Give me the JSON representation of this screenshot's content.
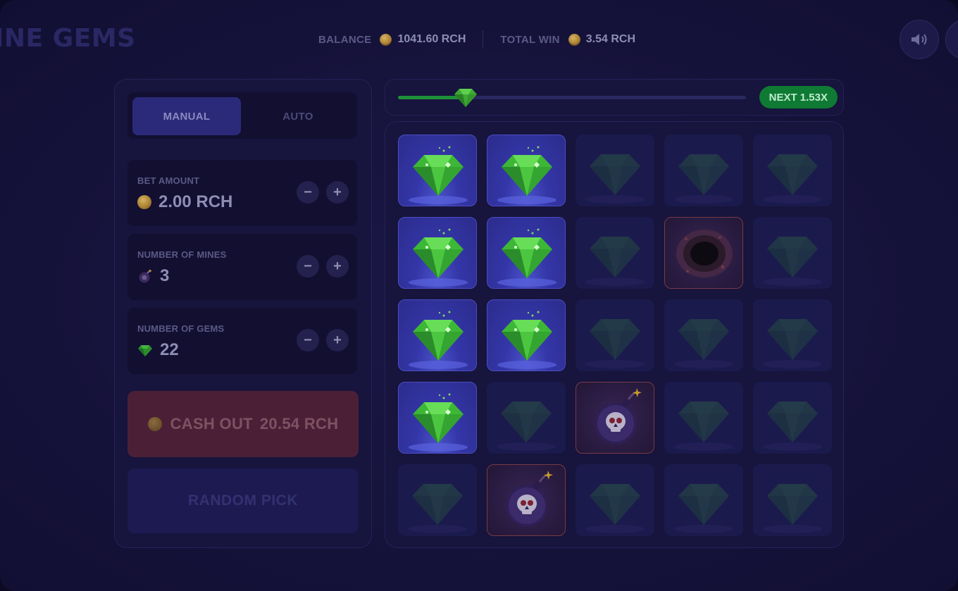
{
  "app": {
    "title_fragment": "INE GEMS"
  },
  "header": {
    "balance_label": "BALANCE",
    "balance_value": "1041.60 RCH",
    "total_win_label": "TOTAL WIN",
    "total_win_value": "3.54 RCH",
    "buttons": [
      {
        "icon": "speaker-icon"
      },
      {
        "icon": "menu-icon"
      }
    ]
  },
  "controls": {
    "tabs": [
      {
        "label": "MANUAL",
        "active": true
      },
      {
        "label": "AUTO",
        "active": false
      }
    ],
    "bet_amount": {
      "label": "BET AMOUNT",
      "value": "2.00 RCH",
      "icon": "coin-icon"
    },
    "mines": {
      "label": "NUMBER OF MINES",
      "value": "3",
      "icon": "bomb-icon"
    },
    "gems": {
      "label": "NUMBER OF GEMS",
      "value": "22",
      "icon": "gem-icon"
    },
    "stepper_minus": "−",
    "stepper_plus": "+",
    "cashout_label": "CASH OUT",
    "cashout_value": "20.54 RCH",
    "random_pick_label": "RANDOM PICK"
  },
  "progress": {
    "fraction": 0.195,
    "next_label": "NEXT 1.53X"
  },
  "board": {
    "rows": 5,
    "cols": 5,
    "tiles": [
      [
        "gem",
        "gem",
        "hidden-gem",
        "hidden-gem",
        "hidden-gem"
      ],
      [
        "gem",
        "gem",
        "hidden-gem",
        "hole",
        "hidden-gem"
      ],
      [
        "gem",
        "gem",
        "hidden-gem",
        "hidden-gem",
        "hidden-gem"
      ],
      [
        "gem",
        "hidden-gem",
        "bomb",
        "hidden-gem",
        "hidden-gem"
      ],
      [
        "hidden-gem",
        "bomb",
        "hidden-gem",
        "hidden-gem",
        "hidden-gem"
      ]
    ]
  },
  "colors": {
    "accent": "#2b2a7a",
    "gem": "#3fbf2f",
    "cashout": "#4b2036",
    "next": "#0f7a33"
  }
}
